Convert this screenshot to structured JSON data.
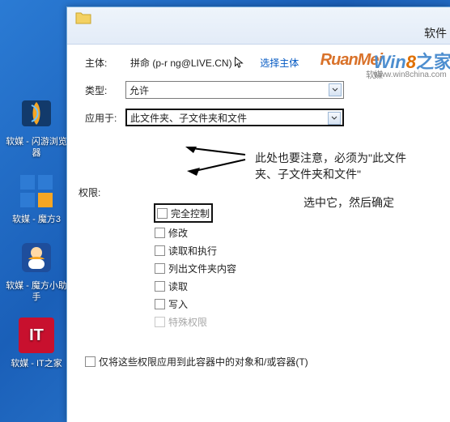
{
  "desktop": {
    "icons": [
      {
        "label": "软媒 - 闪游浏览器"
      },
      {
        "label": "软媒 - 魔方3"
      },
      {
        "label": "软媒 - 魔方小助手"
      },
      {
        "label": "软媒 - IT之家"
      }
    ]
  },
  "window": {
    "title_fragment": "软件"
  },
  "form": {
    "principal_label": "主体:",
    "principal_name": "拼命",
    "principal_account": "(p-r    ng@LIVE.CN)",
    "select_principal_link": "选择主体",
    "type_label": "类型:",
    "type_value": "允许",
    "apply_label": "应用于:",
    "apply_value": "此文件夹、子文件夹和文件"
  },
  "annotation": {
    "arrow_note_line1": "此处也要注意，必须为\"此文件",
    "arrow_note_line2": "夹、子文件夹和文件\"",
    "side_note": "选中它，然后确定"
  },
  "permissions": {
    "header_label": "权限:",
    "items": [
      {
        "label": "完全控制",
        "highlight": true
      },
      {
        "label": "修改"
      },
      {
        "label": "读取和执行"
      },
      {
        "label": "列出文件夹内容"
      },
      {
        "label": "读取"
      },
      {
        "label": "写入"
      },
      {
        "label": "特殊权限",
        "disabled": true
      }
    ],
    "apply_only_label": "仅将这些权限应用到此容器中的对象和/或容器(T)"
  },
  "watermarks": {
    "ruanmei": "RuanMei",
    "ruanmei_cn": "软媒",
    "win8_a": "Win",
    "win8_b": "8",
    "win8_c": "之家",
    "win8_url": "www.win8china.com"
  }
}
